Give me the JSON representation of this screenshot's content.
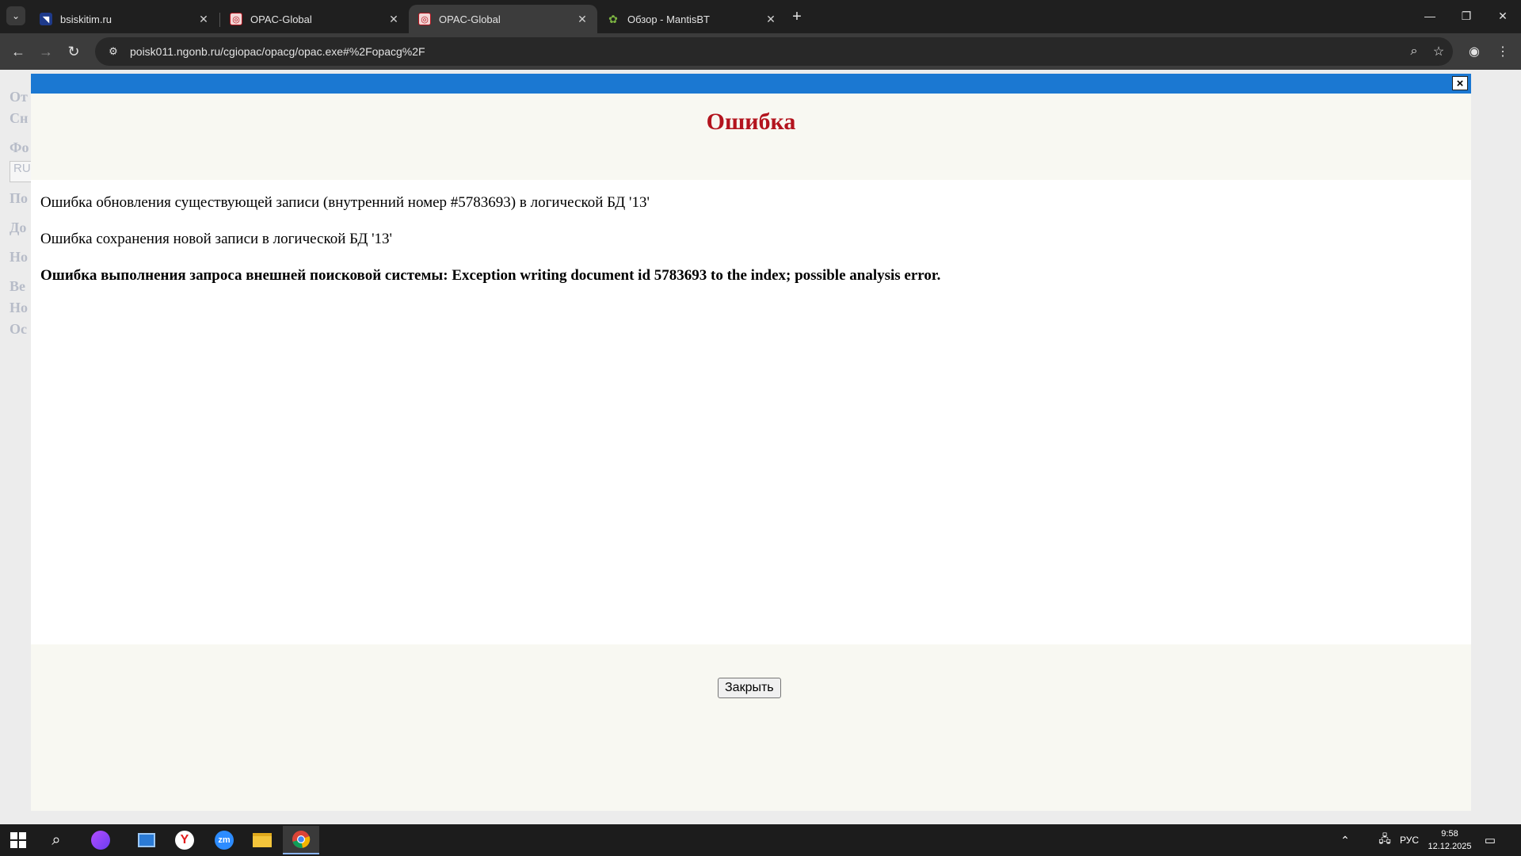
{
  "browser": {
    "tabs": [
      {
        "title": "bsiskitim.ru",
        "active": false
      },
      {
        "title": "OPAC-Global",
        "active": false
      },
      {
        "title": "OPAC-Global",
        "active": true
      },
      {
        "title": "Обзор - MantisBT",
        "active": false
      }
    ],
    "url": "poisk011.ngonb.ru/cgiopac/opacg/opac.exe#%2Fopacg%2F"
  },
  "background_page": {
    "menu_items": [
      "От",
      "Сн",
      "Фо",
      "Пo",
      "До",
      "Но",
      "Ве",
      "Но",
      "Ос"
    ],
    "lang_input_value": "RU"
  },
  "dialog": {
    "title": "Ошибка",
    "messages": [
      "Ошибка обновления существующей записи (внутренний номер #5783693) в логической БД '13'",
      "Ошибка сохранения новой записи в логической БД '13'",
      "Ошибка выполнения запроса внешней поисковой системы: Exception writing document id 5783693 to the index; possible analysis error."
    ],
    "close_button": "Закрыть",
    "close_icon": "×"
  },
  "taskbar": {
    "lang": "РУС",
    "time": "9:58",
    "date": "12.12.2025"
  },
  "colors": {
    "dialog_header_bar": "#1b78d2",
    "dialog_title": "#b3141e",
    "dialog_bg": "#f8f8f2"
  }
}
